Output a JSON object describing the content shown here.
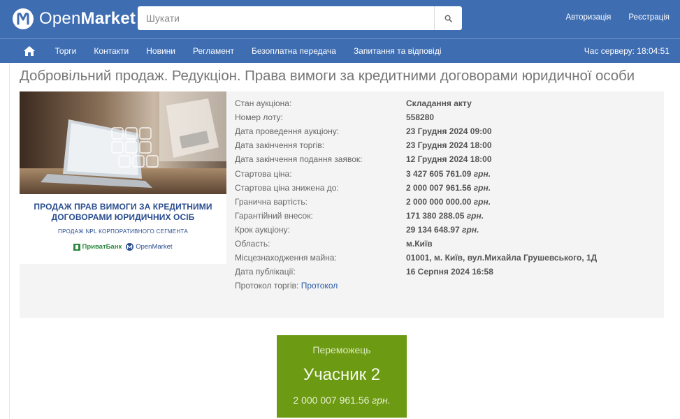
{
  "header": {
    "logo_open": "Open",
    "logo_market": "Market",
    "search_placeholder": "Шукати",
    "login": "Авторизація",
    "register": "Реєстрація"
  },
  "nav": {
    "items": [
      "Торги",
      "Контакти",
      "Новини",
      "Регламент",
      "Безоплатна передача",
      "Запитання та відповіді"
    ],
    "server_time_label": "Час серверу:",
    "server_time": "18:04:51"
  },
  "page": {
    "title": "Добровільний продаж. Редукціон. Права вимоги за кредитними договорами юридичної особи"
  },
  "banner": {
    "heading_line1": "ПРОДАЖ ПРАВ ВИМОГИ ЗА КРЕДИТНИМИ",
    "heading_line2": "ДОГОВОРАМИ ЮРИДИЧНИХ ОСІБ",
    "subheading": "ПРОДАЖ NPL КОРПОРАТИВНОГО СЕГМЕНТА",
    "logo1": "ПриватБанк",
    "logo2": "OpenMarket"
  },
  "details": {
    "status_label": "Стан аукціона:",
    "status": "Складання акту",
    "lot_label": "Номер лоту:",
    "lot": "558280",
    "auction_date_label": "Дата проведення аукціону:",
    "auction_date": "23 Грудня 2024 09:00",
    "trading_end_label": "Дата закінчення торгів:",
    "trading_end": "23 Грудня 2024 18:00",
    "bids_end_label": "Дата закінчення подання заявок:",
    "bids_end": "12 Грудня 2024 18:00",
    "start_price_label": "Стартова ціна:",
    "start_price": "3 427 605 761.09",
    "reduced_price_label": "Стартова ціна знижена до:",
    "reduced_price": "2 000 007 961.56",
    "limit_value_label": "Гранична вартість:",
    "limit_value": "2 000 000 000.00",
    "guarantee_label": "Гарантійний внесок:",
    "guarantee": "171 380 288.05",
    "step_label": "Крок аукціону:",
    "step": "29 134 648.97",
    "region_label": "Область:",
    "region": "м.Київ",
    "location_label": "Місцезнаходження майна:",
    "location": "01001, м. Київ, вул.Михайла Грушевського, 1Д",
    "published_label": "Дата публікації:",
    "published": "16 Серпня 2024 16:58",
    "protocol_label": "Протокол торгів:",
    "protocol_link": "Протокол",
    "currency": "грн."
  },
  "winner": {
    "label": "Переможець",
    "name": "Учасник 2",
    "price": "2 000 007 961.56",
    "currency": "грн."
  }
}
